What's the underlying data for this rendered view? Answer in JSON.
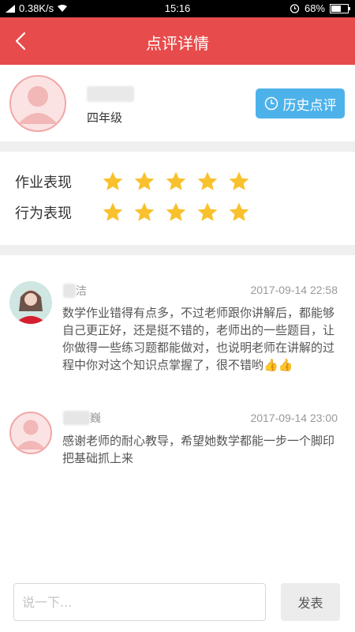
{
  "status_bar": {
    "speed": "0.38K/s",
    "time": "15:16",
    "battery": "68%",
    "battery_level": 0.68
  },
  "header": {
    "title": "点评详情"
  },
  "profile": {
    "grade": "四年级",
    "history_button": "历史点评"
  },
  "ratings": [
    {
      "label": "作业表现",
      "stars": 5,
      "max": 5
    },
    {
      "label": "行为表现",
      "stars": 5,
      "max": 5
    }
  ],
  "comments": [
    {
      "name_visible": "洁",
      "time": "2017-09-14 22:58",
      "text": "数学作业错得有点多，不过老师跟你讲解后，都能够自己更正好，还是挺不错的，老师出的一些题目，让你做得一些练习题都能做对，也说明老师在讲解的过程中你对这个知识点掌握了，很不错哟👍👍"
    },
    {
      "name_visible": "巍",
      "time": "2017-09-14 23:00",
      "text": "感谢老师的耐心教导，希望她数学都能一步一个脚印把基础抓上来"
    }
  ],
  "input": {
    "placeholder": "说一下...",
    "value": "",
    "send_label": "发表"
  },
  "colors": {
    "header_bg": "#e84b4b",
    "history_button_bg": "#4db2ea",
    "star": "#f8c12d"
  }
}
